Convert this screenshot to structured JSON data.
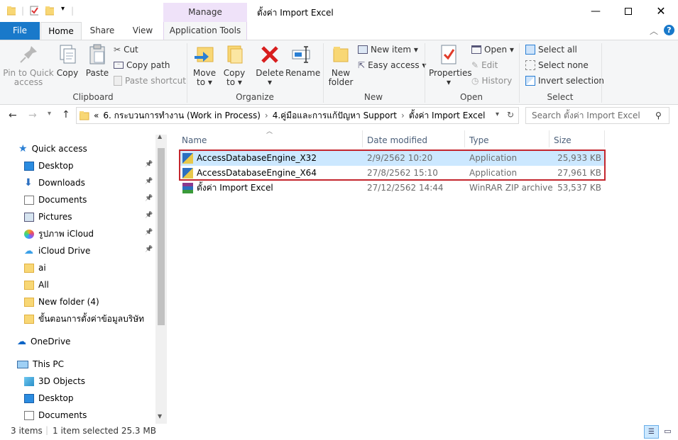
{
  "window": {
    "title": "ตั้งค่า Import Excel",
    "contextual_tab": "Manage"
  },
  "ribbon_tabs": {
    "file": "File",
    "home": "Home",
    "share": "Share",
    "view": "View",
    "app_tools": "Application Tools"
  },
  "clipboard": {
    "pin_line1": "Pin to Quick",
    "pin_line2": "access",
    "copy": "Copy",
    "paste": "Paste",
    "cut": "Cut",
    "copy_path": "Copy path",
    "paste_shortcut": "Paste shortcut",
    "label": "Clipboard"
  },
  "organize": {
    "move_to_1": "Move",
    "move_to_2": "to ▾",
    "copy_to_1": "Copy",
    "copy_to_2": "to ▾",
    "delete_1": "Delete",
    "delete_2": "▾",
    "rename": "Rename",
    "label": "Organize"
  },
  "new": {
    "new_folder_1": "New",
    "new_folder_2": "folder",
    "new_item": "New item ▾",
    "easy_access": "Easy access ▾",
    "label": "New"
  },
  "open": {
    "properties_1": "Properties",
    "properties_2": "▾",
    "open": "Open ▾",
    "edit": "Edit",
    "history": "History",
    "label": "Open"
  },
  "select": {
    "select_all": "Select all",
    "select_none": "Select none",
    "invert": "Invert selection",
    "label": "Select"
  },
  "address": {
    "prefix": "«",
    "crumb1": "6. กระบวนการทำงาน (Work in Process)",
    "crumb2": "4.คู่มือและการแก้ปัญหา Support",
    "crumb3": "ตั้งค่า Import Excel",
    "sep": "›"
  },
  "search": {
    "placeholder": "Search ตั้งค่า Import Excel"
  },
  "sidebar": {
    "quick_access": "Quick access",
    "items": [
      {
        "label": "Desktop",
        "pinned": true
      },
      {
        "label": "Downloads",
        "pinned": true
      },
      {
        "label": "Documents",
        "pinned": true
      },
      {
        "label": "Pictures",
        "pinned": true
      },
      {
        "label": "รูปภาพ iCloud",
        "pinned": true
      },
      {
        "label": "iCloud Drive",
        "pinned": true
      },
      {
        "label": "ai",
        "pinned": false
      },
      {
        "label": "All",
        "pinned": false
      },
      {
        "label": "New folder (4)",
        "pinned": false
      },
      {
        "label": "ขั้นตอนการตั้งค่าข้อมูลบริษัท",
        "pinned": false
      }
    ],
    "onedrive": "OneDrive",
    "this_pc": "This PC",
    "pc_items": [
      "3D Objects",
      "Desktop",
      "Documents"
    ]
  },
  "columns": {
    "name": "Name",
    "date": "Date modified",
    "type": "Type",
    "size": "Size"
  },
  "files": [
    {
      "name": "AccessDatabaseEngine_X32",
      "date": "2/9/2562 10:20",
      "type": "Application",
      "size": "25,933 KB",
      "icon": "installer-icon"
    },
    {
      "name": "AccessDatabaseEngine_X64",
      "date": "27/8/2562 15:10",
      "type": "Application",
      "size": "27,961 KB",
      "icon": "installer-icon"
    },
    {
      "name": "ตั้งค่า Import Excel",
      "date": "27/12/2562 14:44",
      "type": "WinRAR ZIP archive",
      "size": "53,537 KB",
      "icon": "winrar-icon"
    }
  ],
  "status": {
    "count": "3 items",
    "selected": "1 item selected  25.3 MB"
  },
  "colors": {
    "accent": "#1979ca",
    "selection": "#cce8ff",
    "highlight_box": "#c4262e",
    "manage_tab": "#efe2f9"
  }
}
